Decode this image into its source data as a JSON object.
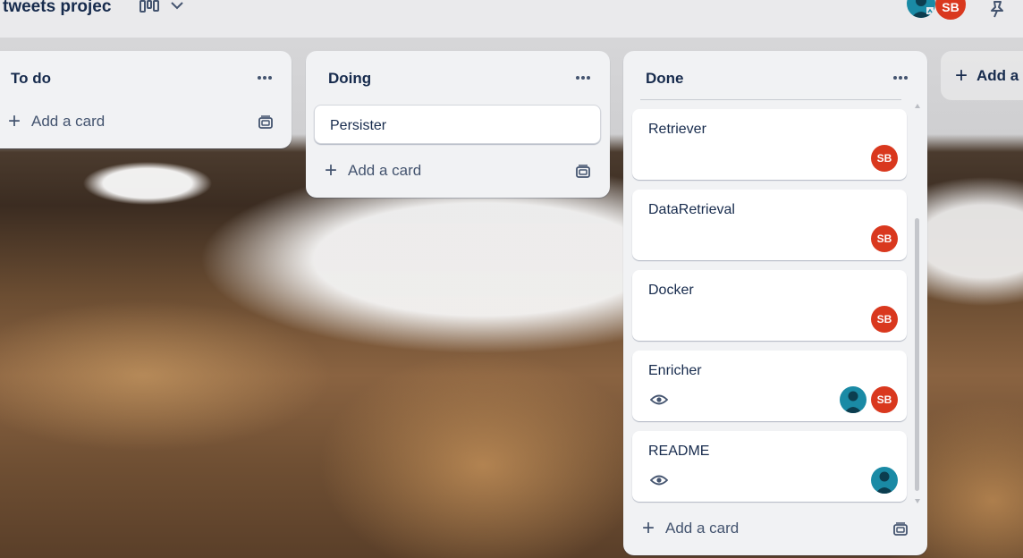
{
  "header": {
    "board_title": "tweets projec",
    "view_icon": "board-columns-icon",
    "dropdown_icon": "chevron-down-icon",
    "members": [
      {
        "type": "avatar-person",
        "color": "#1a8aa5"
      },
      {
        "initials": "SB",
        "color": "#d9381e"
      }
    ],
    "pin_icon": "pin-icon"
  },
  "lists": [
    {
      "title": "To do",
      "add_label": "Add a card",
      "cards": []
    },
    {
      "title": "Doing",
      "add_label": "Add a card",
      "cards": [
        {
          "title": "Persister"
        }
      ]
    },
    {
      "title": "Done",
      "add_label": "Add a card",
      "cards": [
        {
          "title": "Retriever",
          "members": [
            "SB"
          ],
          "watching": false
        },
        {
          "title": "DataRetrieval",
          "members": [
            "SB"
          ],
          "watching": false
        },
        {
          "title": "Docker",
          "members": [
            "SB"
          ],
          "watching": false
        },
        {
          "title": "Enricher",
          "members": [
            "person",
            "SB"
          ],
          "watching": true
        },
        {
          "title": "README",
          "members": [
            "person"
          ],
          "watching": true
        }
      ]
    }
  ],
  "add_list_label": "Add a",
  "colors": {
    "accent_red": "#d9381e",
    "accent_teal": "#1a8aa5",
    "list_bg": "#f1f2f4",
    "text": "#172b4d"
  }
}
